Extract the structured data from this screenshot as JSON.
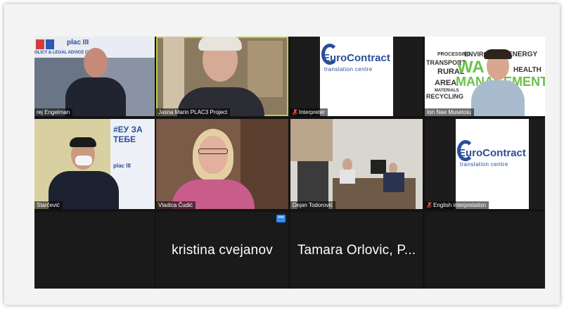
{
  "tiles": [
    {
      "name": "rej Engelman",
      "banner": "OLICY & LEGAL ADVICE CENT",
      "logo_text": "plac III"
    },
    {
      "name": "Jasna Marin PLAC3 Project"
    },
    {
      "name": "Interpreter",
      "logo_title": "EuroContract",
      "logo_sub": "translation centre"
    },
    {
      "name": "Ion Nae Musetoiu",
      "cloud_words": [
        "PROCESSING",
        "ENVIRO",
        "ENERGY",
        "TRANSPORT",
        "RURAL",
        "HEALTH",
        "AREA",
        "MANAGEMENT",
        "MATERIALS",
        "RECYCLING",
        "WA"
      ]
    },
    {
      "name": "Starčević",
      "poster_text": "#ЕУ ЗА ТЕБЕ",
      "logo_text": "plac III"
    },
    {
      "name": "Vladica Čudić"
    },
    {
      "name": "Dejan Todorović"
    },
    {
      "name": "English interpretation",
      "logo_title": "EuroContract",
      "logo_sub": "translation centre"
    },
    {
      "name": "kristina cvejanov"
    },
    {
      "name": "Tamara Orlovic, P..."
    }
  ],
  "more_button": "•••",
  "colors": {
    "active_speaker": "#b7d04a",
    "zoom_blue": "#2d8cff",
    "logo_blue": "#2a4f99",
    "cloud_green": "#6cc04a"
  }
}
